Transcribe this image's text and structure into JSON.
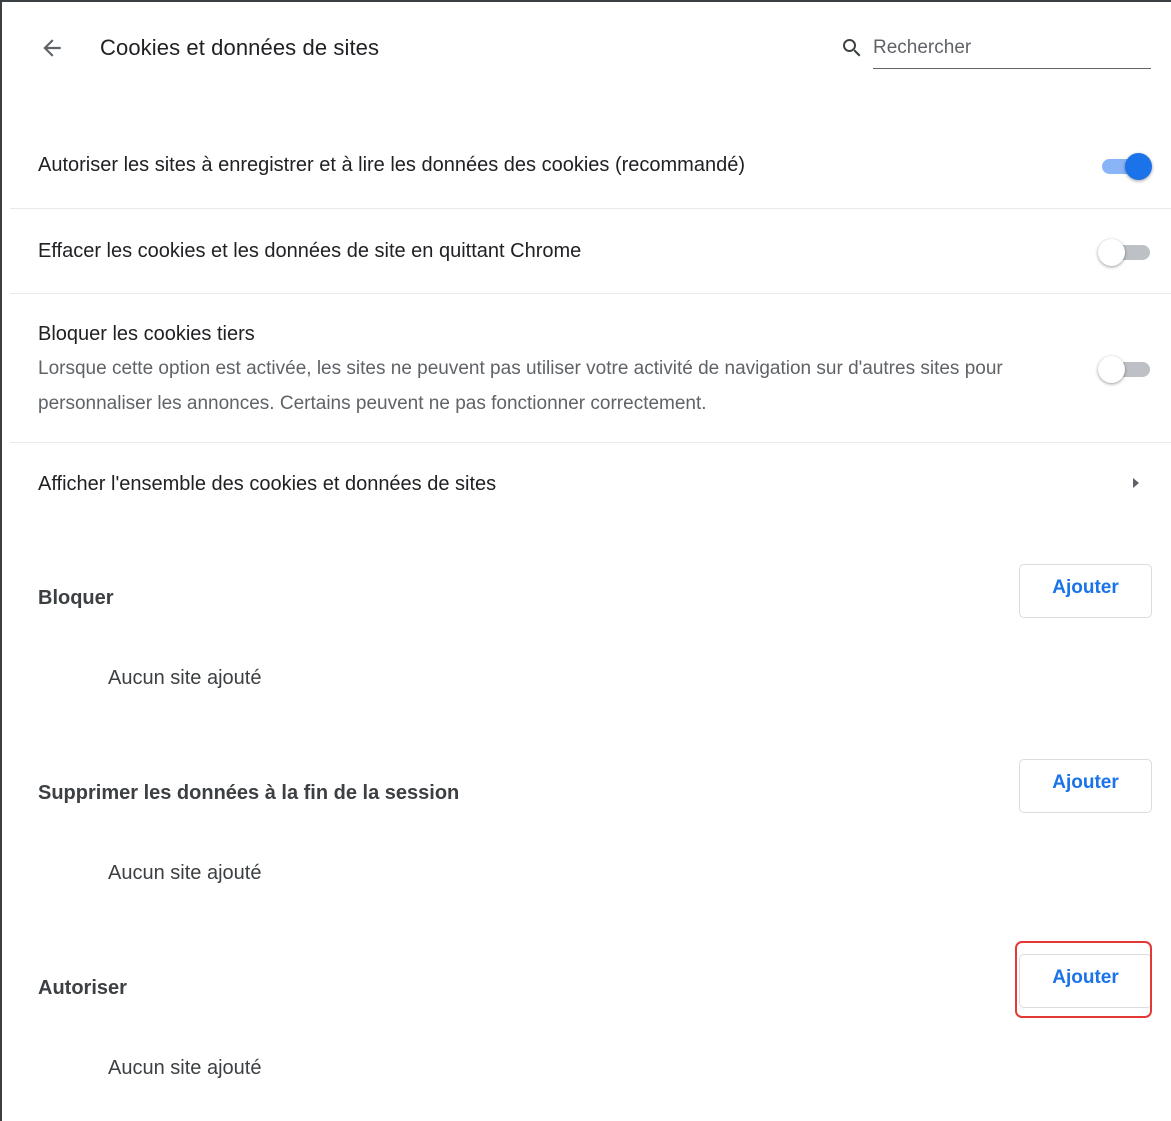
{
  "header": {
    "title": "Cookies et données de sites",
    "search_placeholder": "Rechercher"
  },
  "icons": {
    "back": "arrow-back-icon",
    "search": "search-icon",
    "chevron": "chevron-right-icon"
  },
  "colors": {
    "accent": "#1a73e8",
    "toggle_on_track": "#8ab4f8",
    "highlight": "#e53935"
  },
  "settings": {
    "allow_cookies": {
      "label": "Autoriser les sites à enregistrer et à lire les données des cookies (recommandé)",
      "enabled": true
    },
    "clear_on_exit": {
      "label": "Effacer les cookies et les données de site en quittant Chrome",
      "enabled": false
    },
    "block_third_party": {
      "label": "Bloquer les cookies tiers",
      "description": "Lorsque cette option est activée, les sites ne peuvent pas utiliser votre activité de navigation sur d'autres sites pour personnaliser les annonces. Certains peuvent ne pas fonctionner correctement.",
      "enabled": false
    },
    "see_all": {
      "label": "Afficher l'ensemble des cookies et données de sites"
    }
  },
  "sections": {
    "block": {
      "title": "Bloquer",
      "add_label": "Ajouter",
      "empty_text": "Aucun site ajouté"
    },
    "clear_on_exit": {
      "title": "Supprimer les données à la fin de la session",
      "add_label": "Ajouter",
      "empty_text": "Aucun site ajouté"
    },
    "allow": {
      "title": "Autoriser",
      "add_label": "Ajouter",
      "empty_text": "Aucun site ajouté"
    }
  }
}
